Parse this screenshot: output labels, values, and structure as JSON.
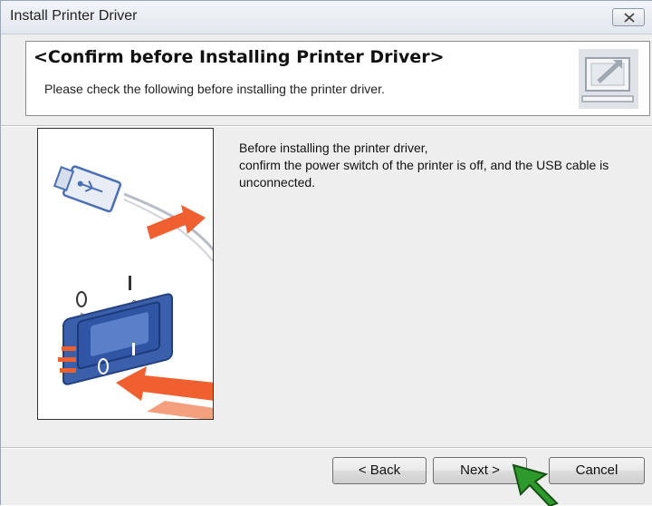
{
  "window": {
    "title": "Install Printer Driver"
  },
  "header": {
    "title": "<Confirm before Installing Printer Driver>",
    "subtitle": "Please check the following before installing the printer driver."
  },
  "message": {
    "lines": [
      "Before installing the printer driver,",
      "confirm the power switch of the printer is off, and the USB cable is",
      "unconnected."
    ]
  },
  "illustration": {
    "switch_off_label": "Off",
    "switch_on_label": "On"
  },
  "buttons": {
    "back": "< Back",
    "next": "Next >",
    "cancel": "Cancel"
  },
  "colors": {
    "arrow": "#ef5f2f",
    "usb_plug": "#4a6fb5",
    "switch_blue": "#2f55a4",
    "cursor": "#2e9a2e"
  },
  "icons": {
    "close": "close-icon",
    "header": "install-monitor-icon",
    "cursor": "mouse-pointer-icon"
  }
}
